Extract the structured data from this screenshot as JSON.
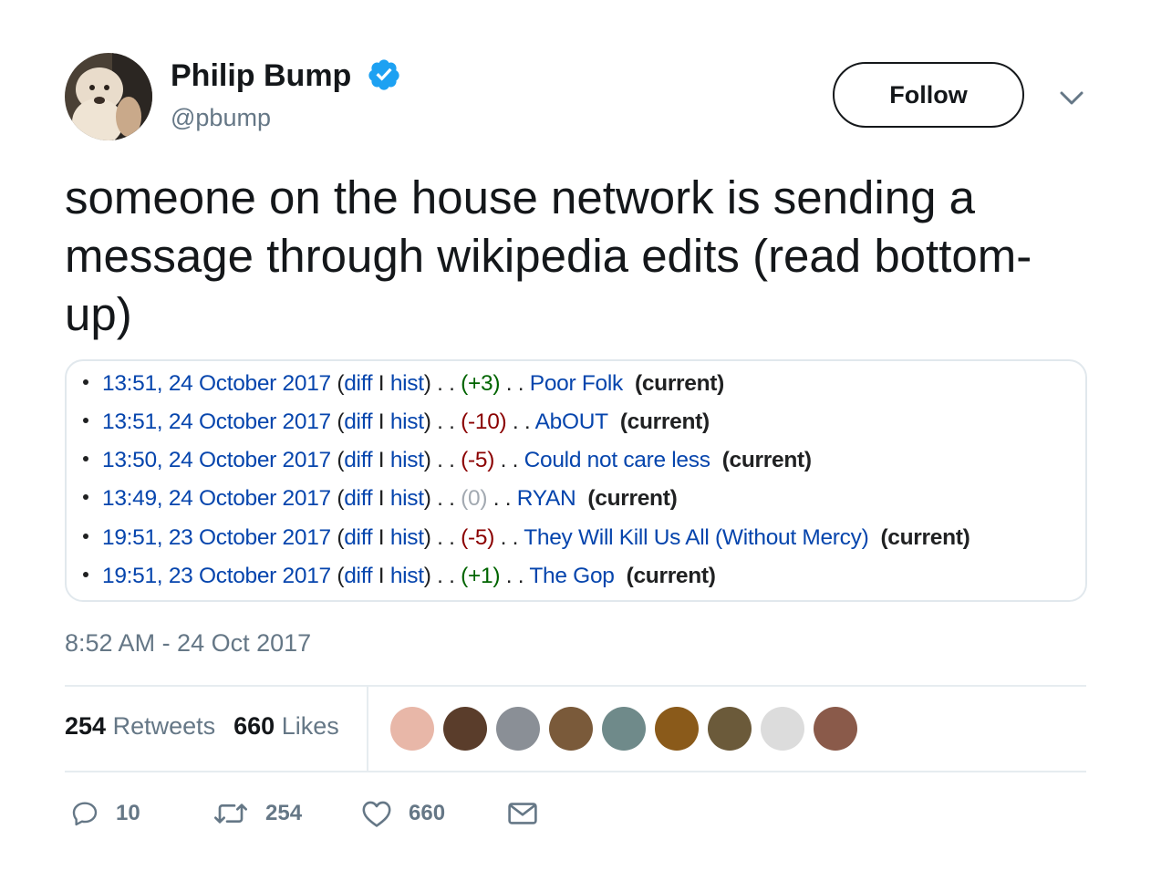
{
  "author": {
    "name": "Philip Bump",
    "handle": "@pbump",
    "verified": true
  },
  "follow_label": "Follow",
  "tweet_text": "someone on the house network is sending a message through wikipedia edits (read bottom-up)",
  "edits": [
    {
      "datetime": "13:51, 24 October 2017",
      "diff": "diff",
      "sep": "I",
      "hist": "hist",
      "change": "(+3)",
      "change_sign": "pos",
      "title": "Poor Folk",
      "status": "(current)"
    },
    {
      "datetime": "13:51, 24 October 2017",
      "diff": "diff",
      "sep": "I",
      "hist": "hist",
      "change": "(-10)",
      "change_sign": "neg",
      "title": "AbOUT",
      "status": "(current)"
    },
    {
      "datetime": "13:50, 24 October 2017",
      "diff": "diff",
      "sep": "I",
      "hist": "hist",
      "change": "(-5)",
      "change_sign": "neg",
      "title": "Could not care less",
      "status": "(current)"
    },
    {
      "datetime": "13:49, 24 October 2017",
      "diff": "diff",
      "sep": "I",
      "hist": "hist",
      "change": "(0)",
      "change_sign": "zero",
      "title": "RYAN",
      "status": "(current)"
    },
    {
      "datetime": "19:51, 23 October 2017",
      "diff": "diff",
      "sep": "I",
      "hist": "hist",
      "change": "(-5)",
      "change_sign": "neg",
      "title": "They Will Kill Us All (Without Mercy)",
      "status": "(current)"
    },
    {
      "datetime": "19:51, 23 October 2017",
      "diff": "diff",
      "sep": "I",
      "hist": "hist",
      "change": "(+1)",
      "change_sign": "pos",
      "title": "The Gop",
      "status": "(current)"
    }
  ],
  "timestamp": "8:52 AM - 24 Oct 2017",
  "stats": {
    "retweets_count": "254",
    "retweets_label": "Retweets",
    "likes_count": "660",
    "likes_label": "Likes"
  },
  "liker_avatar_colors": [
    "#e8b7a8",
    "#5a3d2b",
    "#8a8f96",
    "#7a5a3a",
    "#6f8a8a",
    "#8a5a1a",
    "#6b5a3a",
    "#dcdcdc",
    "#8a5a4a"
  ],
  "actions": {
    "reply_count": "10",
    "retweet_count": "254",
    "like_count": "660"
  },
  "colors": {
    "verified_blue": "#1da1f2",
    "link_blue": "#0645ad",
    "secondary_text": "#657786"
  }
}
